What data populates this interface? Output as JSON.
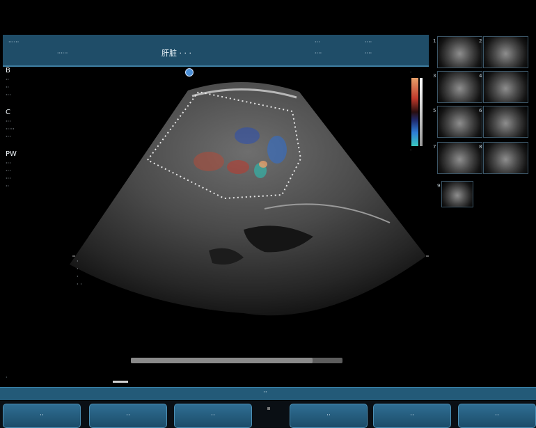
{
  "header": {
    "left_top": "······",
    "left_bottom": "······",
    "title": "肝脏 · · ·",
    "right_top_1": "···",
    "right_top_2": "····",
    "right_bottom_1": "····",
    "right_bottom_2": "····"
  },
  "left_panel": {
    "groups": [
      {
        "title": "B",
        "rows": [
          "··",
          "··",
          "···"
        ]
      },
      {
        "title": "C",
        "rows": [
          "···",
          "·····",
          "···"
        ]
      },
      {
        "title": "PW",
        "rows": [
          "···",
          "···",
          "···",
          "··"
        ]
      }
    ]
  },
  "colorbar": {
    "top_label": "·",
    "bottom_label": "·",
    "colors": [
      "#e8a06a",
      "#c0392b",
      "#1f2a6e",
      "#3bc9c0"
    ]
  },
  "mid_info": [
    "·",
    "·",
    "·",
    "· ·"
  ],
  "thumbnails": [
    {
      "label": "1"
    },
    {
      "label": "2"
    },
    {
      "label": "3"
    },
    {
      "label": "4"
    },
    {
      "label": "5"
    },
    {
      "label": "6"
    },
    {
      "label": "7"
    },
    {
      "label": "8"
    },
    {
      "label": "9"
    }
  ],
  "progress": {
    "value": 0.86
  },
  "status": {
    "label": "··"
  },
  "softkeys": [
    {
      "label": "··"
    },
    {
      "label": "··"
    },
    {
      "label": "··"
    },
    {
      "label": "··"
    },
    {
      "label": "··"
    },
    {
      "label": "··"
    }
  ]
}
